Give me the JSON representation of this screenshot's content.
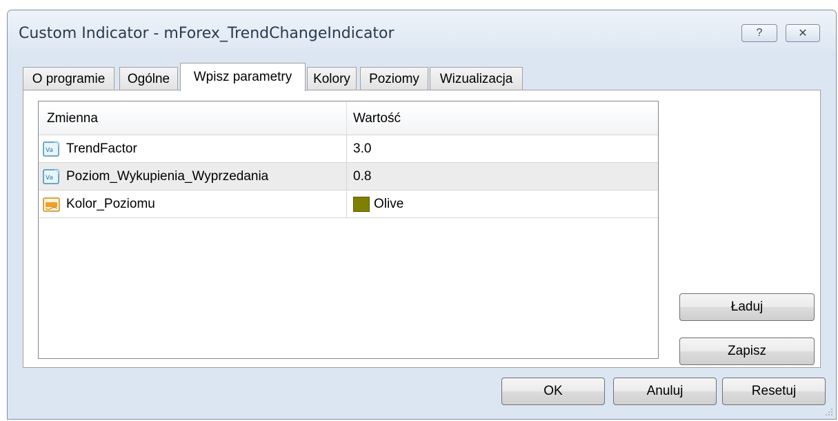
{
  "window": {
    "title": "Custom Indicator - mForex_TrendChangeIndicator",
    "help_label": "?",
    "close_label": "✕"
  },
  "tabs": [
    {
      "label": "O programie",
      "active": false
    },
    {
      "label": "Ogólne",
      "active": false
    },
    {
      "label": "Wpisz parametry",
      "active": true
    },
    {
      "label": "Kolory",
      "active": false
    },
    {
      "label": "Poziomy",
      "active": false
    },
    {
      "label": "Wizualizacja",
      "active": false
    }
  ],
  "grid": {
    "columns": [
      "Zmienna",
      "Wartość"
    ],
    "rows": [
      {
        "name": "TrendFactor",
        "value": "3.0",
        "icon": "variable-icon"
      },
      {
        "name": "Poziom_Wykupienia_Wyprzedania",
        "value": "0.8",
        "icon": "variable-icon"
      },
      {
        "name": "Kolor_Poziomu",
        "value": "Olive",
        "icon": "color-variable-icon",
        "swatch_color": "#808000"
      }
    ]
  },
  "side_buttons": {
    "load_label": "Ładuj",
    "save_label": "Zapisz"
  },
  "footer": {
    "ok_label": "OK",
    "cancel_label": "Anuluj",
    "reset_label": "Resetuj"
  }
}
